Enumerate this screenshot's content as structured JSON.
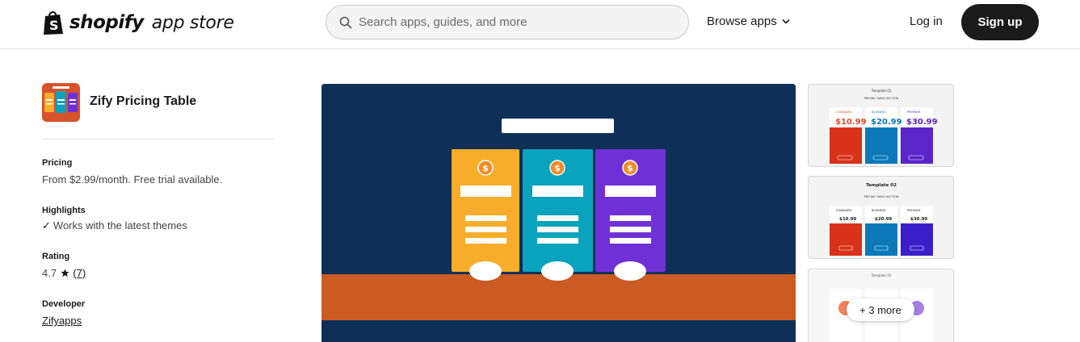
{
  "header": {
    "brand": "shopify",
    "brand_suffix": "app store",
    "search_placeholder": "Search apps, guides, and more",
    "browse_label": "Browse apps",
    "login_label": "Log in",
    "signup_label": "Sign up"
  },
  "app": {
    "name": "Zify Pricing Table",
    "pricing_label": "Pricing",
    "pricing_value": "From $2.99/month. Free trial available.",
    "highlights_label": "Highlights",
    "highlight_item": "Works with the latest themes",
    "rating_label": "Rating",
    "rating_value": "4.7",
    "rating_count": "(7)",
    "developer_label": "Developer",
    "developer_name": "Zifyapps"
  },
  "thumbnails": {
    "thumb1_title": "Template 01",
    "thumb1_subtitle": "PRICING TABLE SECTION",
    "thumb1_plans": [
      "STANDARD",
      "BUSINESS",
      "PREMIUM"
    ],
    "thumb1_prices": [
      "$10.99",
      "$20.99",
      "$30.99"
    ],
    "thumb2_title": "Template 02",
    "thumb2_subtitle": "PRICING TABLE SECTION",
    "thumb2_plans": [
      "STANDARD",
      "BUSINESS",
      "PREMIUM"
    ],
    "thumb2_prices": [
      "$10.99",
      "$20.99",
      "$30.99"
    ],
    "thumb3_title": "Template 03",
    "more_label": "+ 3 more"
  },
  "colors": {
    "hero_bg": "#0e3057",
    "card_orange": "#f7ad2b",
    "card_teal": "#0aa3bd",
    "card_purple": "#6f31d6",
    "band": "#cc5a23",
    "signup_bg": "#1b1b1b"
  }
}
